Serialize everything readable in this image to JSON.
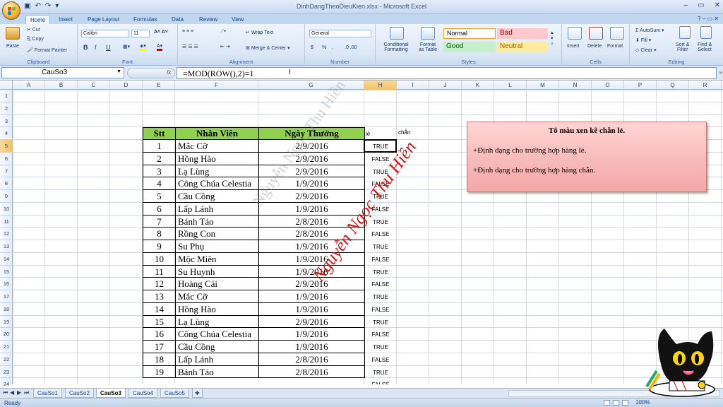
{
  "window": {
    "title": "DinhDangTheoDieuKien.xlsx - Microsoft Excel",
    "controls": [
      "–",
      "▭",
      "✕"
    ]
  },
  "ribbon_tabs": {
    "items": [
      "Home",
      "Insert",
      "Page Layout",
      "Formulas",
      "Data",
      "Review",
      "View"
    ],
    "active": "Home"
  },
  "clipboard": {
    "paste": "Paste",
    "cut": "Cut",
    "copy": "Copy",
    "format_painter": "Format Painter",
    "group": "Clipboard"
  },
  "font": {
    "name": "Calibri",
    "size": "11",
    "bold": "B",
    "italic": "I",
    "underline": "U",
    "group": "Font"
  },
  "alignment": {
    "wrap": "Wrap Text",
    "merge": "Merge & Center",
    "group": "Alignment"
  },
  "number": {
    "format": "General",
    "currency": "$",
    "percent": "%",
    "comma": ",",
    "group": "Number"
  },
  "styles": {
    "conditional": "Conditional Formatting",
    "conditional_l1": "Conditional",
    "conditional_l2": "Formatting",
    "format_table_l1": "Format",
    "format_table_l2": "as Table",
    "normal": "Normal",
    "bad": "Bad",
    "good": "Good",
    "neutral": "Neutral",
    "group": "Styles"
  },
  "cells_group": {
    "insert": "Insert",
    "delete": "Delete",
    "format": "Format",
    "group": "Cells"
  },
  "editing": {
    "autosum": "AutoSum",
    "fill": "Fill",
    "clear": "Clear",
    "sort_l1": "Sort &",
    "sort_l2": "Filter",
    "find_l1": "Find &",
    "find_l2": "Select",
    "group": "Editing"
  },
  "formula_bar": {
    "name_box": "CauSo3",
    "fx": "fx",
    "formula": "=MOD(ROW(),2)=1"
  },
  "columns": [
    "A",
    "B",
    "C",
    "D",
    "E",
    "F",
    "G",
    "H",
    "I",
    "J",
    "K",
    "L",
    "M",
    "N",
    "O",
    "P",
    "Q",
    "R"
  ],
  "selected_column": "H",
  "rows": [
    "1",
    "2",
    "3",
    "4",
    "5",
    "6",
    "7",
    "8",
    "9",
    "10",
    "11",
    "12",
    "13",
    "14",
    "15",
    "16",
    "17",
    "18",
    "19",
    "20",
    "21",
    "22",
    "23",
    "24"
  ],
  "selected_row": "5",
  "table": {
    "headers": [
      "Stt",
      "Nhân Viên",
      "Ngày Thưởng"
    ],
    "rows": [
      [
        "1",
        "Mắc Cỡ",
        "2/9/2016"
      ],
      [
        "2",
        "Hồng Hào",
        "2/9/2016"
      ],
      [
        "3",
        "Lạ Lùng",
        "2/9/2016"
      ],
      [
        "4",
        "Công Chúa Celestia",
        "1/9/2016"
      ],
      [
        "5",
        "Cầu Cồng",
        "2/9/2016"
      ],
      [
        "6",
        "Lấp Lánh",
        "1/9/2016"
      ],
      [
        "7",
        "Bánh Táo",
        "2/8/2016"
      ],
      [
        "8",
        "Rồng Con",
        "2/8/2016"
      ],
      [
        "9",
        "Su Phụ",
        "1/9/2016"
      ],
      [
        "10",
        "Mộc Miên",
        "1/9/2016"
      ],
      [
        "11",
        "Su Huynh",
        "1/9/2016"
      ],
      [
        "12",
        "Hoàng Cái",
        "2/9/2016"
      ],
      [
        "13",
        "Mắc Cỡ",
        "1/9/2016"
      ],
      [
        "14",
        "Hồng Hào",
        "1/9/2016"
      ],
      [
        "15",
        "Lạ Lùng",
        "2/9/2016"
      ],
      [
        "16",
        "Công Chúa Celestia",
        "1/9/2016"
      ],
      [
        "17",
        "Cầu Cồng",
        "1/9/2016"
      ],
      [
        "18",
        "Lấp Lánh",
        "2/8/2016"
      ],
      [
        "19",
        "Bánh Táo",
        "2/8/2016"
      ]
    ]
  },
  "helper": {
    "h_header": "lẻ",
    "i_header": "chẵn",
    "values": [
      "TRUE",
      "FALSE",
      "TRUE",
      "FALSE",
      "TRUE",
      "FALSE",
      "TRUE",
      "FALSE",
      "TRUE",
      "FALSE",
      "TRUE",
      "FALSE",
      "TRUE",
      "FALSE",
      "TRUE",
      "FALSE",
      "TRUE",
      "FALSE",
      "TRUE",
      "FALSE"
    ]
  },
  "note": {
    "title": "Tô  màu xen kẽ chẵn lẻ.",
    "line1": "+Định dạng cho trường hợp hàng lẻ.",
    "line2": "+Định dạng cho trường hợp hàng chẵn."
  },
  "watermark": {
    "gray": "Nguyễn Ngọc Thu Hiền",
    "red": "Nguyễn Ngọc Thu Hiền"
  },
  "sheets": {
    "items": [
      "CauSo1",
      "CauSo2",
      "CauSo3",
      "CauSo4",
      "CauSo5"
    ],
    "active": "CauSo3"
  },
  "status": {
    "ready": "Ready",
    "zoom": "100%"
  }
}
